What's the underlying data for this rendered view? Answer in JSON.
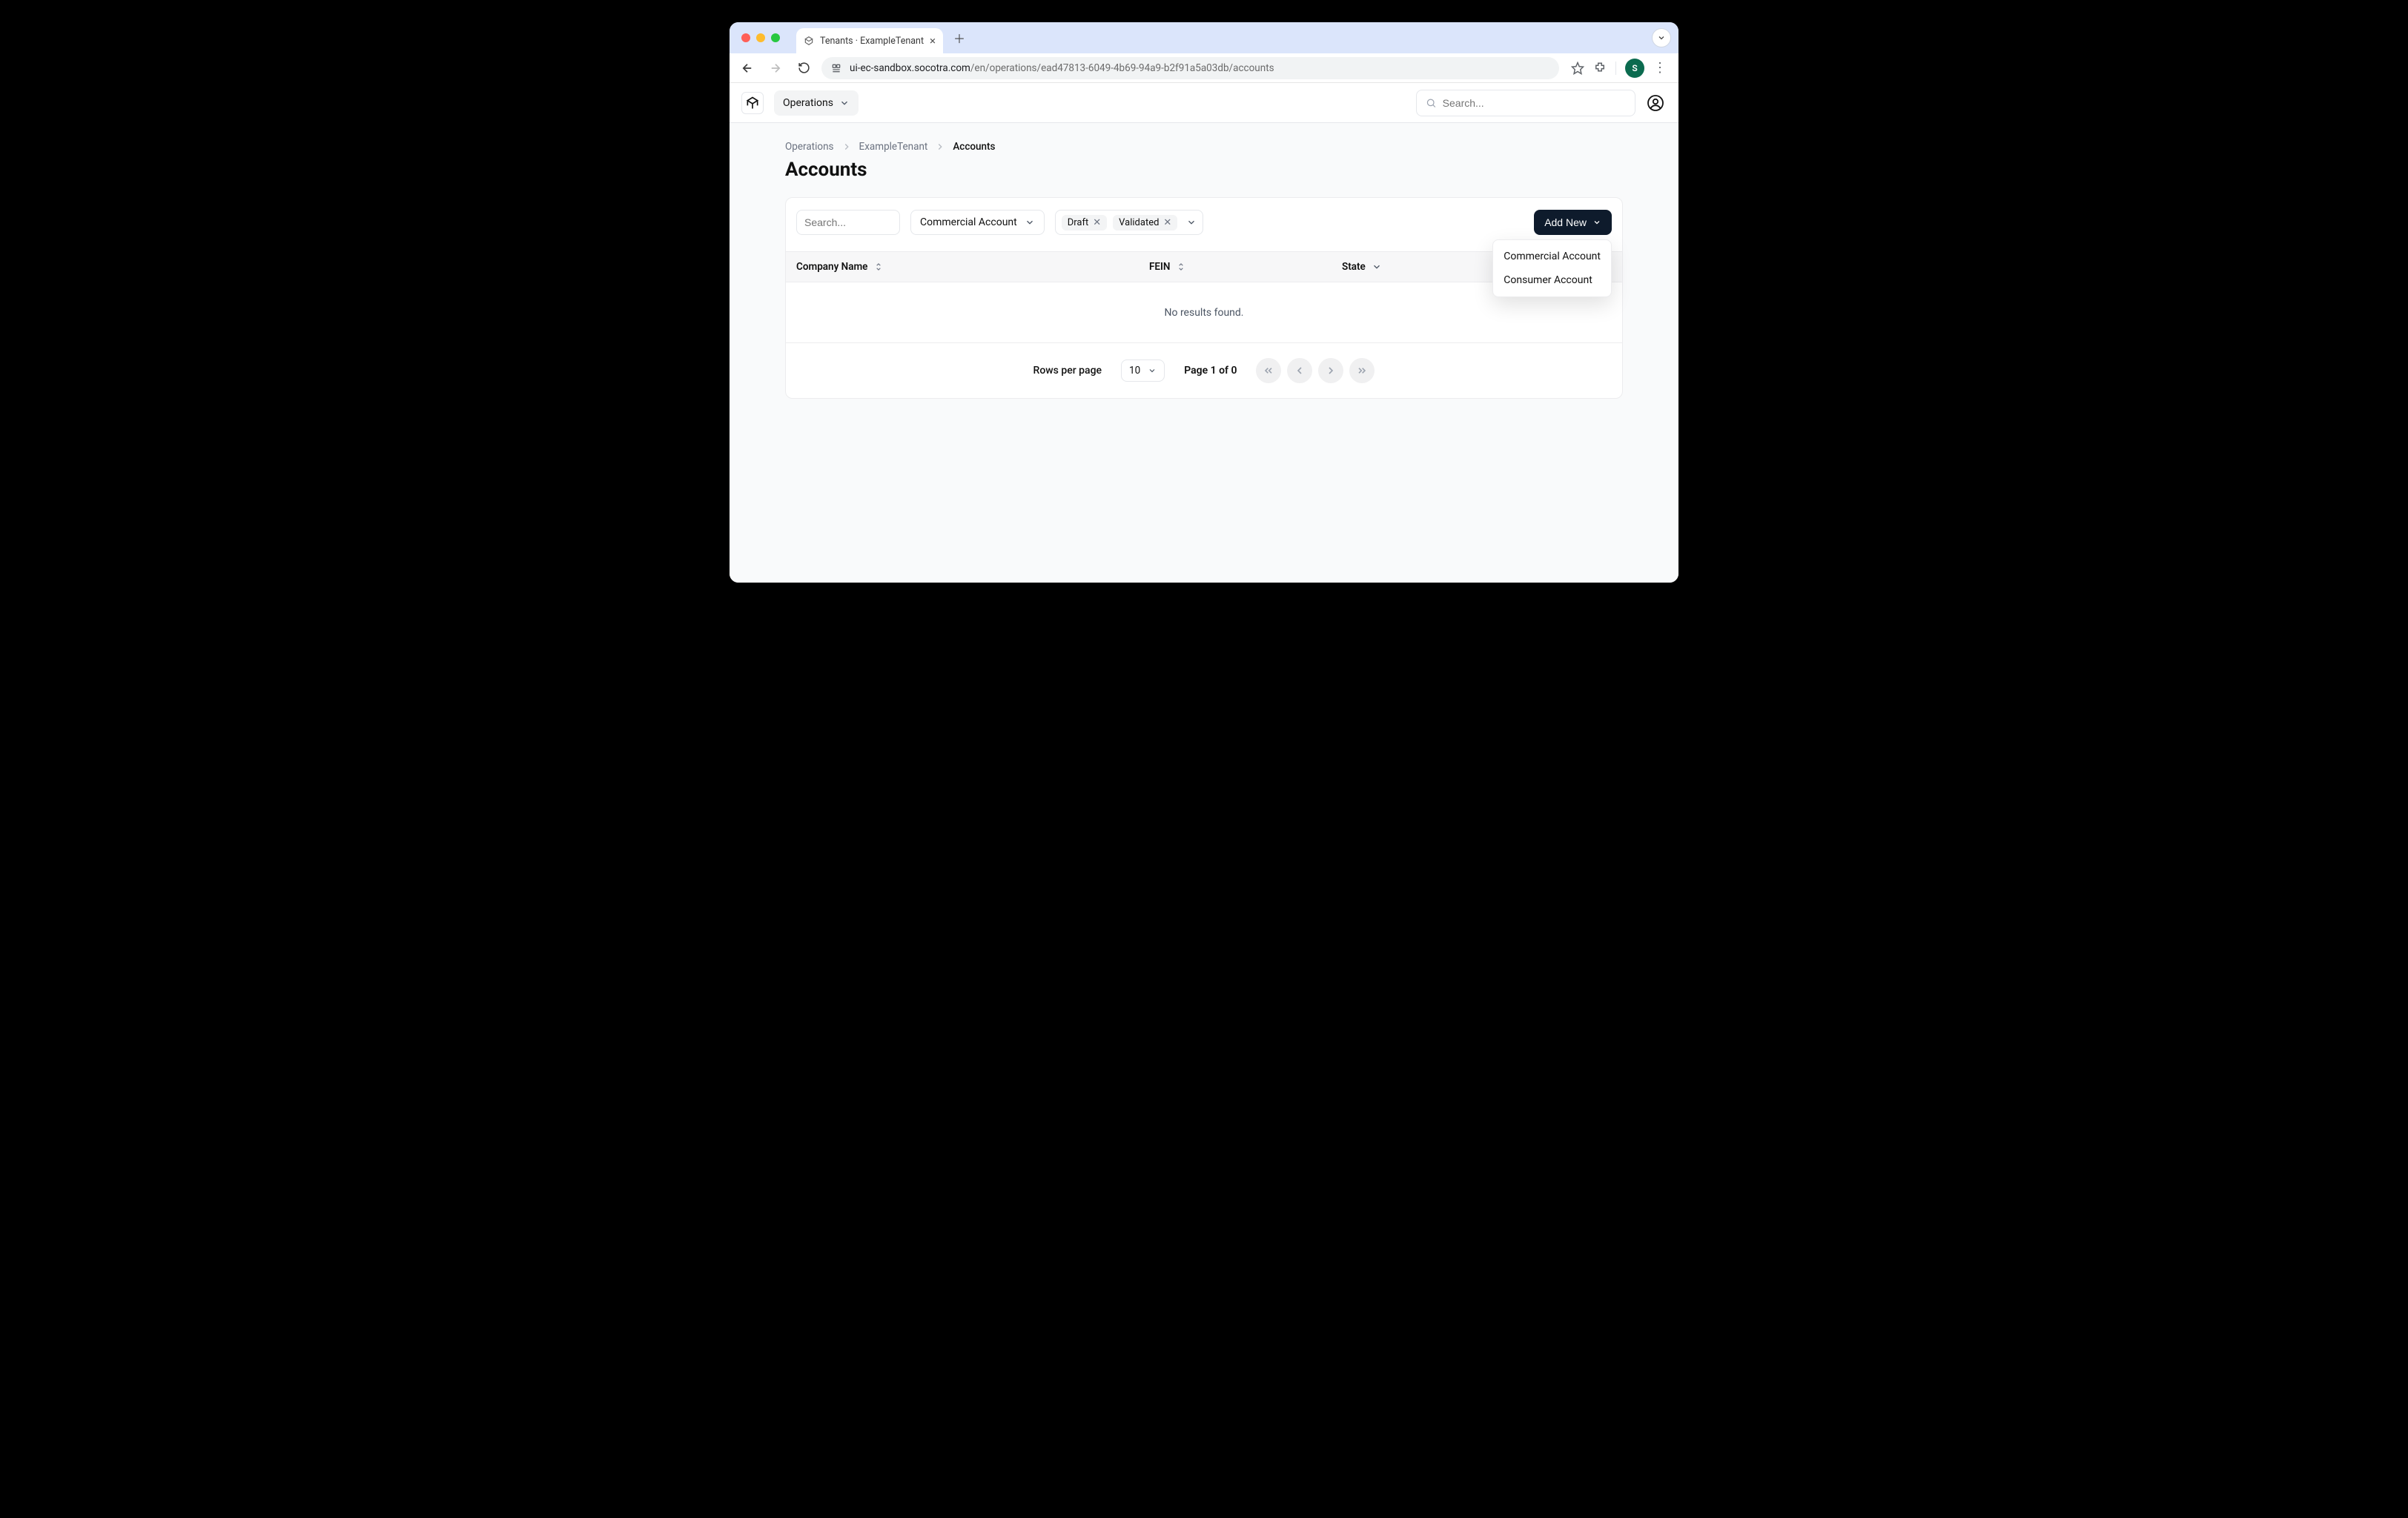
{
  "browser": {
    "tab_title": "Tenants · ExampleTenant",
    "url_host": "ui-ec-sandbox.socotra.com",
    "url_path": "/en/operations/ead47813-6049-4b69-94a9-b2f91a5a03db/accounts",
    "profile_initial": "S"
  },
  "header": {
    "nav_label": "Operations",
    "search_placeholder": "Search..."
  },
  "breadcrumb": {
    "items": [
      "Operations",
      "ExampleTenant",
      "Accounts"
    ]
  },
  "page": {
    "title": "Accounts"
  },
  "filters": {
    "search_placeholder": "Search...",
    "type_select": "Commercial Account",
    "chips": [
      "Draft",
      "Validated"
    ],
    "add_new_label": "Add New",
    "add_new_menu": [
      "Commercial Account",
      "Consumer Account"
    ]
  },
  "table": {
    "columns": [
      "Company Name",
      "FEIN",
      "State"
    ],
    "empty_message": "No results found."
  },
  "pagination": {
    "rows_label": "Rows per page",
    "rows_value": "10",
    "page_status": "Page 1 of 0"
  }
}
